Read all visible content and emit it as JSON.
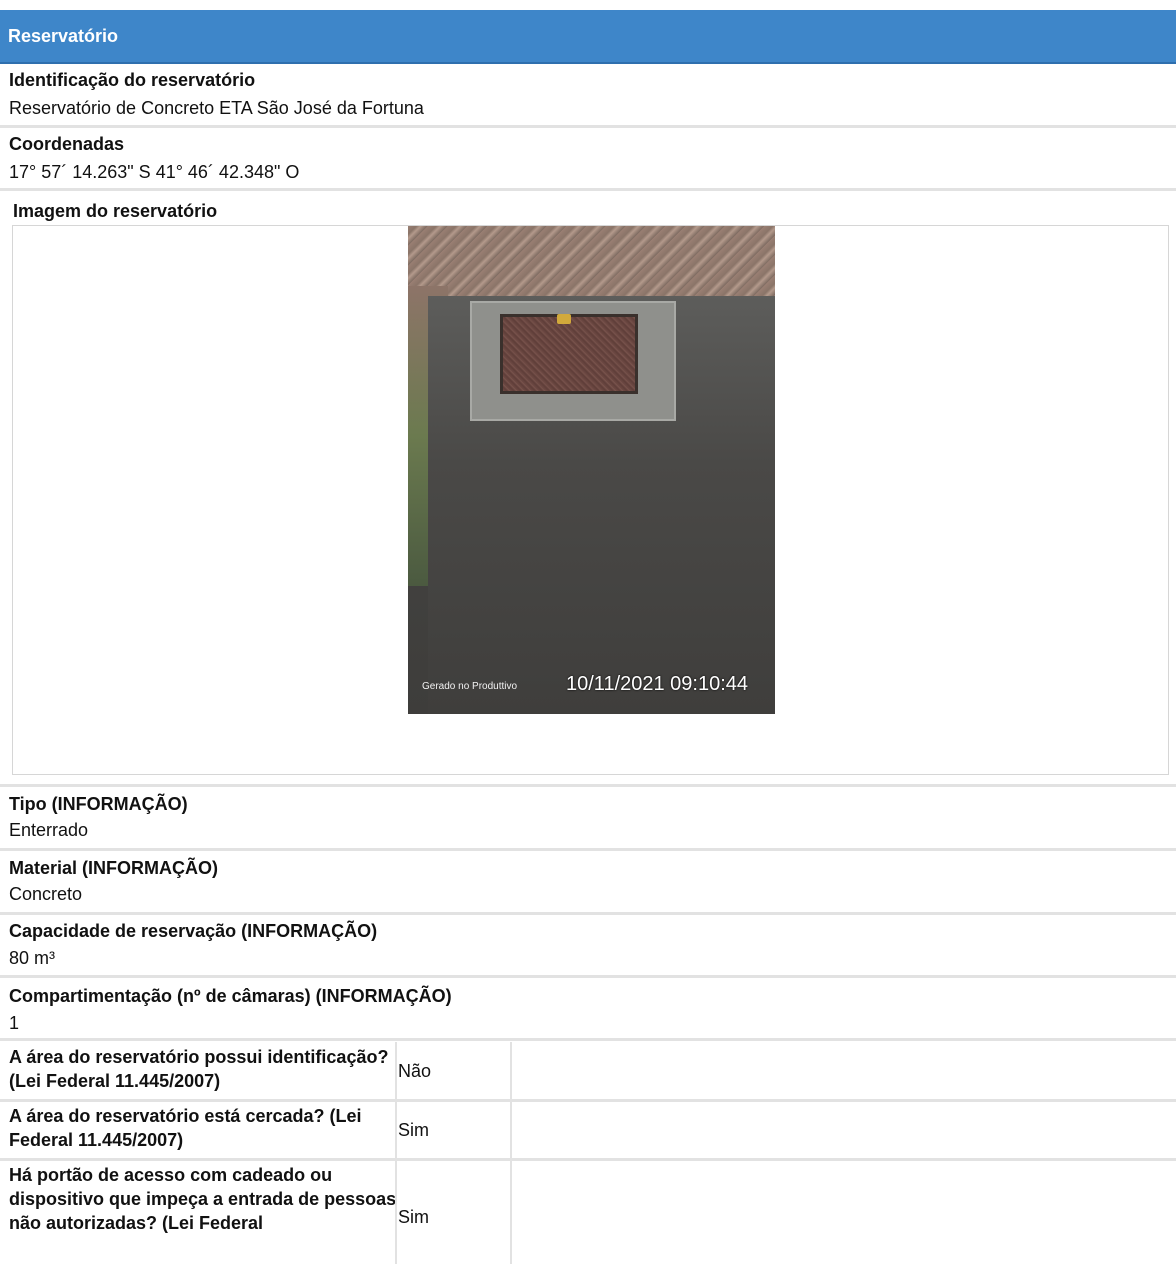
{
  "section": {
    "title": "Reservatório"
  },
  "fields": [
    {
      "label": "Identificação do reservatório",
      "value": "Reservatório de Concreto ETA São José da Fortuna"
    },
    {
      "label": "Coordenadas",
      "value": "17° 57´ 14.263\" S 41° 46´ 42.348\" O"
    }
  ],
  "image_field": {
    "label": "Imagem do reservatório",
    "photo_source_text": "Gerado no Produttivo",
    "photo_timestamp": "10/11/2021 09:10:44"
  },
  "info_fields": [
    {
      "label": "Tipo (INFORMAÇÃO)",
      "value": "Enterrado"
    },
    {
      "label": "Material (INFORMAÇÃO)",
      "value": "Concreto"
    },
    {
      "label": "Capacidade de reservação (INFORMAÇÃO)",
      "value": "80 m³"
    },
    {
      "label": "Compartimentação (nº de câmaras) (INFORMAÇÃO)",
      "value": "1"
    }
  ],
  "checklist": [
    {
      "question": "A área do reservatório possui identificação? (Lei Federal 11.445/2007)",
      "answer": "Não"
    },
    {
      "question": "A área do reservatório está cercada? (Lei Federal 11.445/2007)",
      "answer": "Sim"
    },
    {
      "question": "Há portão de acesso com cadeado ou dispositivo que impeça a entrada de pessoas não autorizadas? (Lei Federal",
      "answer": "Sim"
    }
  ]
}
